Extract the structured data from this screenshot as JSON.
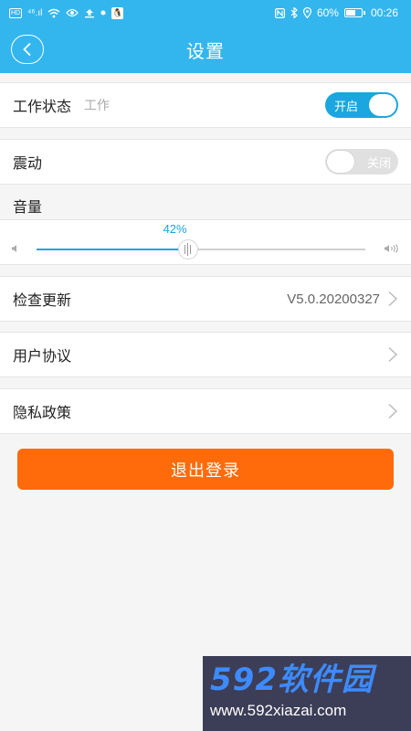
{
  "status_bar": {
    "network_badge": "HD",
    "signal": "⁴⁶.ıl",
    "battery": "60%",
    "time": "00:26"
  },
  "header": {
    "title": "设置"
  },
  "rows": {
    "work_status": {
      "label": "工作状态",
      "sublabel": "工作",
      "toggle": "开启",
      "toggle_on": true
    },
    "vibrate": {
      "label": "震动",
      "toggle": "关闭",
      "toggle_on": false
    },
    "check_update": {
      "label": "检查更新",
      "value": "V5.0.20200327"
    },
    "user_agreement": {
      "label": "用户协议"
    },
    "privacy_policy": {
      "label": "隐私政策"
    }
  },
  "volume": {
    "label": "音量",
    "percent_text": "42%",
    "level": 0.46
  },
  "logout": {
    "label": "退出登录"
  },
  "watermark": {
    "brand": "592软件园",
    "url": "www.592xiazai.com"
  },
  "colors": {
    "primary": "#33b6ee",
    "toggle_on": "#1aa6df",
    "logout": "#ff6b0a"
  }
}
